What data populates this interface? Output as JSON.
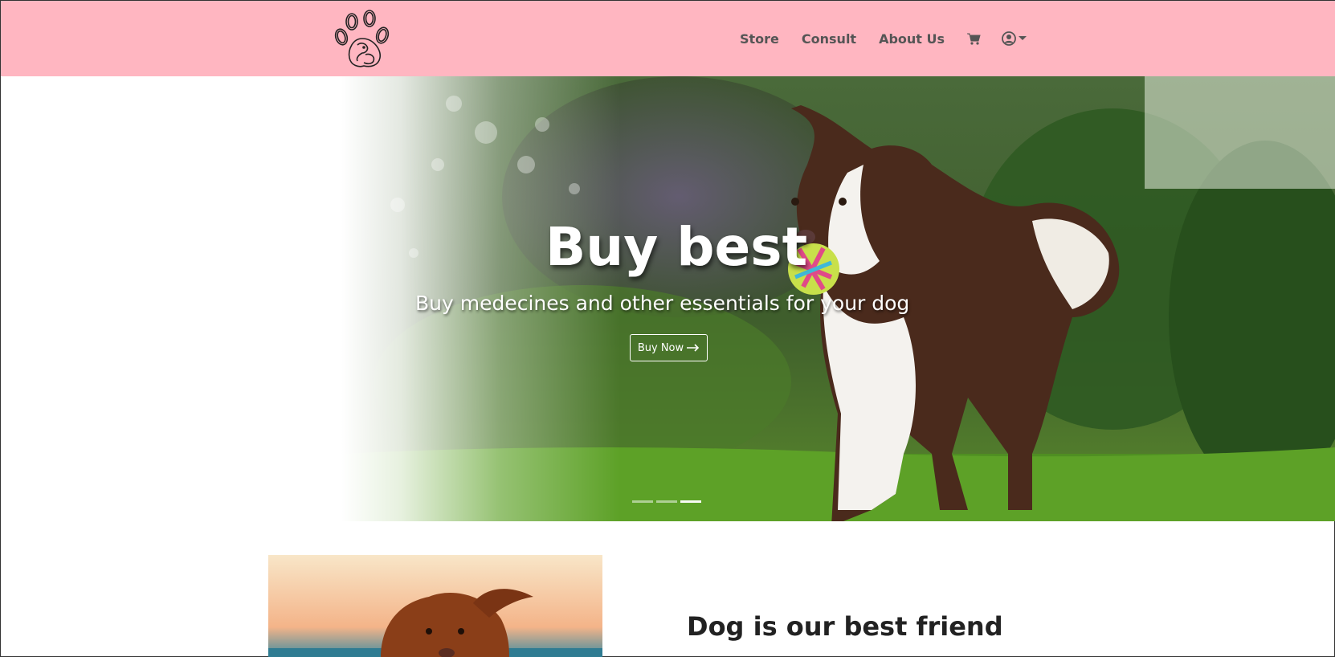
{
  "nav": {
    "links": [
      "Store",
      "Consult",
      "About Us"
    ],
    "icons": [
      "cart-icon",
      "user-circle-icon"
    ]
  },
  "hero": {
    "title": "Buy best",
    "subtitle": "Buy medecines and other essentials for your dog",
    "button_label": "Buy Now",
    "button_icon": "arrow-right-icon",
    "slides": 3,
    "active_slide": 3
  },
  "feature": {
    "title": "Dog is our best friend"
  },
  "colors": {
    "navbar": "#ffb6c1",
    "nav_text": "#555555",
    "hero_text": "#ffffff",
    "heading_text": "#222222"
  }
}
